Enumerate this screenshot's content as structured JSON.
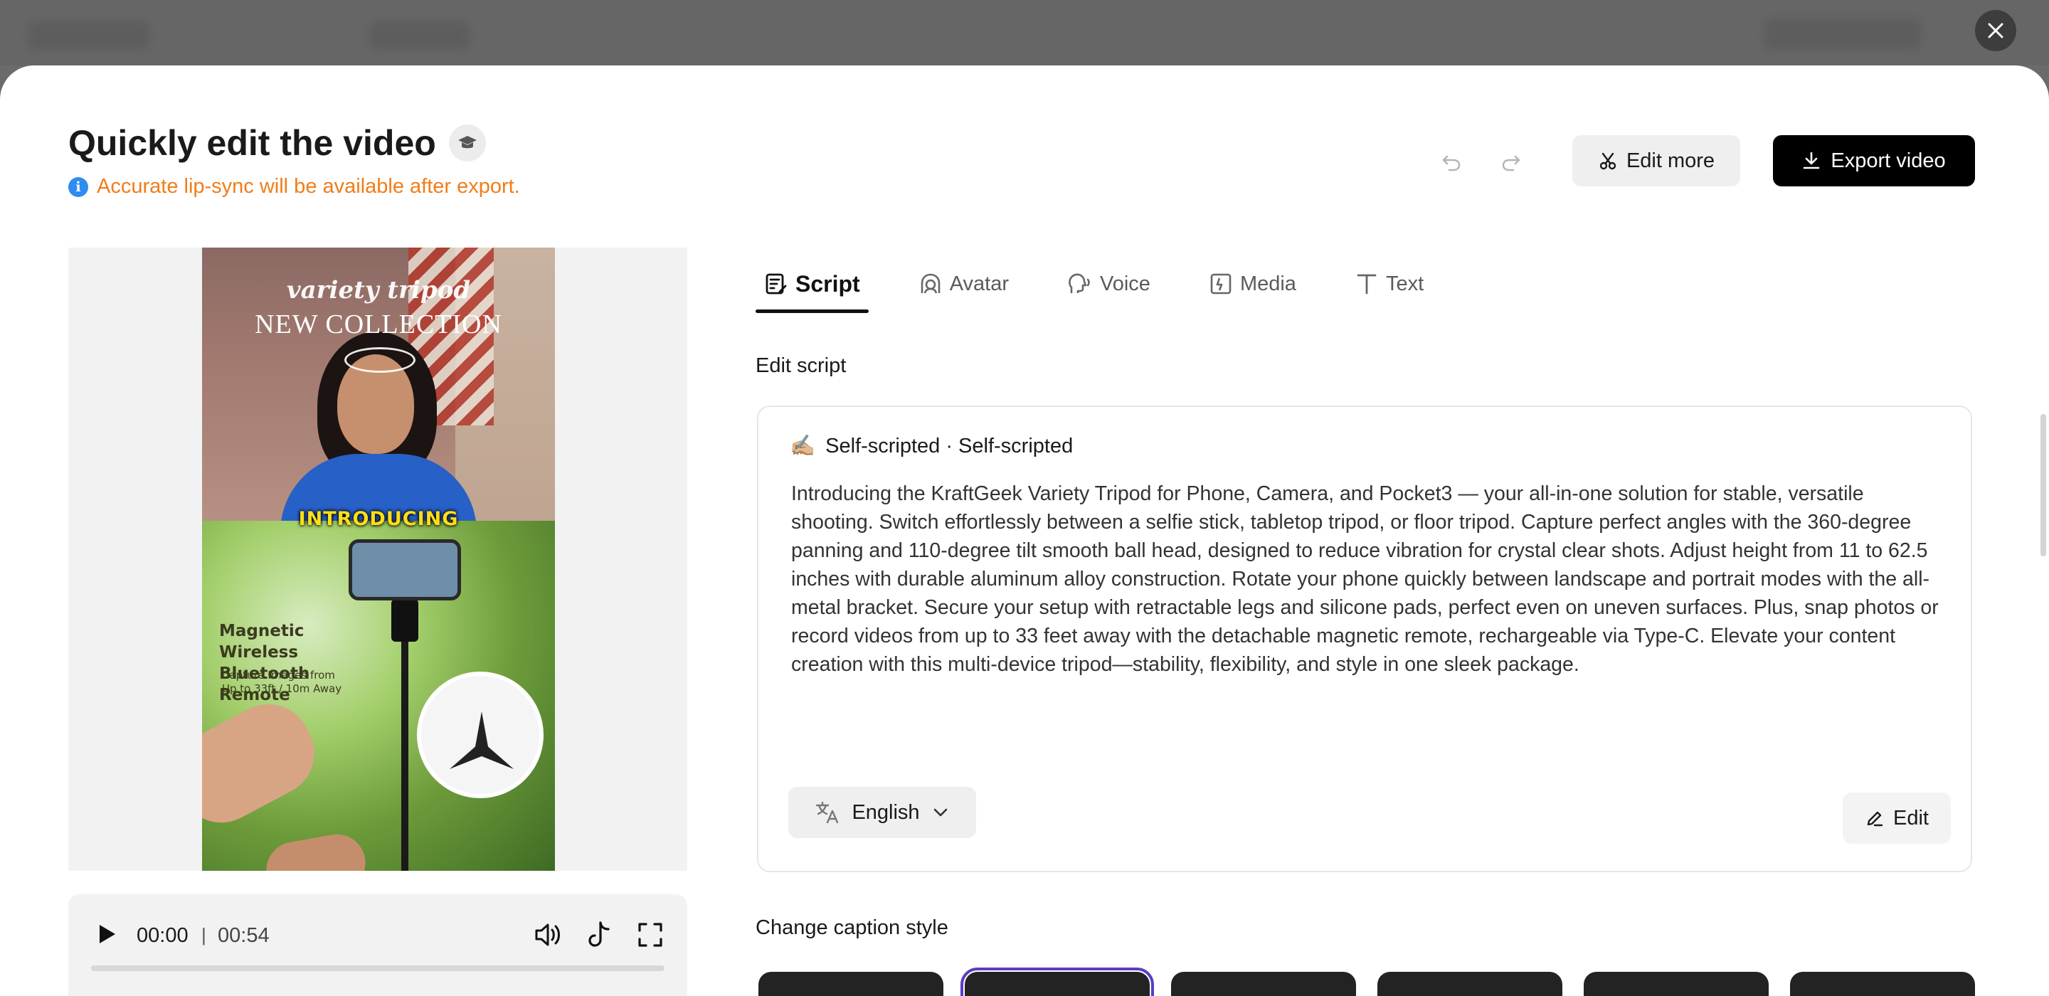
{
  "header": {
    "title": "Quickly edit the video",
    "notice": "Accurate lip-sync will be available after export.",
    "edit_more_label": "Edit more",
    "export_label": "Export video"
  },
  "video": {
    "overlay_line1": "variety tripod",
    "overlay_line2": "NEW COLLECTION",
    "overlay_intro": "INTRODUCING",
    "overlay_feature_title": "Magnetic Wireless Bluetooth Remote",
    "overlay_feature_sub": "Capture Images from Up to 33ft / 10m Away"
  },
  "player": {
    "current_time": "00:00",
    "separator": "|",
    "total_time": "00:54",
    "progress": 0
  },
  "tabs": [
    {
      "label": "Script",
      "icon": "script-icon",
      "active": true
    },
    {
      "label": "Avatar",
      "icon": "avatar-icon",
      "active": false
    },
    {
      "label": "Voice",
      "icon": "voice-icon",
      "active": false
    },
    {
      "label": "Media",
      "icon": "media-icon",
      "active": false
    },
    {
      "label": "Text",
      "icon": "text-icon",
      "active": false
    }
  ],
  "script": {
    "section_label": "Edit script",
    "emoji": "✍🏼",
    "heading": "Self-scripted · Self-scripted",
    "body": "Introducing the KraftGeek Variety Tripod for Phone, Camera, and Pocket3 — your all-in-one solution for stable, versatile shooting. Switch effortlessly between a selfie stick, tabletop tripod, or floor tripod. Capture perfect angles with the 360-degree panning and 110-degree tilt smooth ball head, designed to reduce vibration for crystal clear shots. Adjust height from 11 to 62.5 inches with durable aluminum alloy construction. Rotate your phone quickly between landscape and portrait modes with the all-metal bracket. Secure your setup with retractable legs and silicone pads, perfect even on uneven surfaces. Plus, snap photos or record videos from up to 33 feet away with the detachable magnetic remote, rechargeable via Type-C. Elevate your content creation with this multi-device tripod—stability, flexibility, and style in one sleek package.",
    "language": "English",
    "edit_label": "Edit"
  },
  "caption": {
    "section_label": "Change caption style",
    "styles_count": 6,
    "selected_index": 1
  },
  "colors": {
    "notice": "#f07d1a",
    "info": "#2f8cf0",
    "selected_outline": "#5b3cc4"
  }
}
